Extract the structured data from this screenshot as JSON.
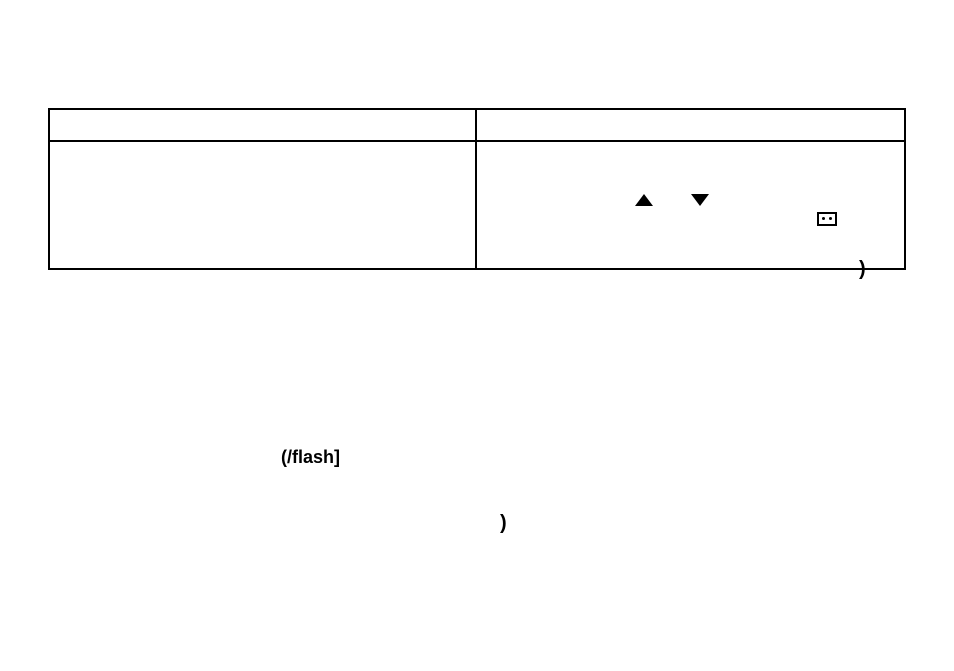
{
  "table": {
    "row1": {
      "col1": "",
      "col2": ""
    },
    "row2": {
      "col1": "",
      "col2": {
        "upArrow": "up-triangle",
        "downArrow": "down-triangle",
        "boxIcon": "dotted-box",
        "paren": ")"
      }
    }
  },
  "flashLabel": "(/flash]",
  "lowerParen": ")"
}
